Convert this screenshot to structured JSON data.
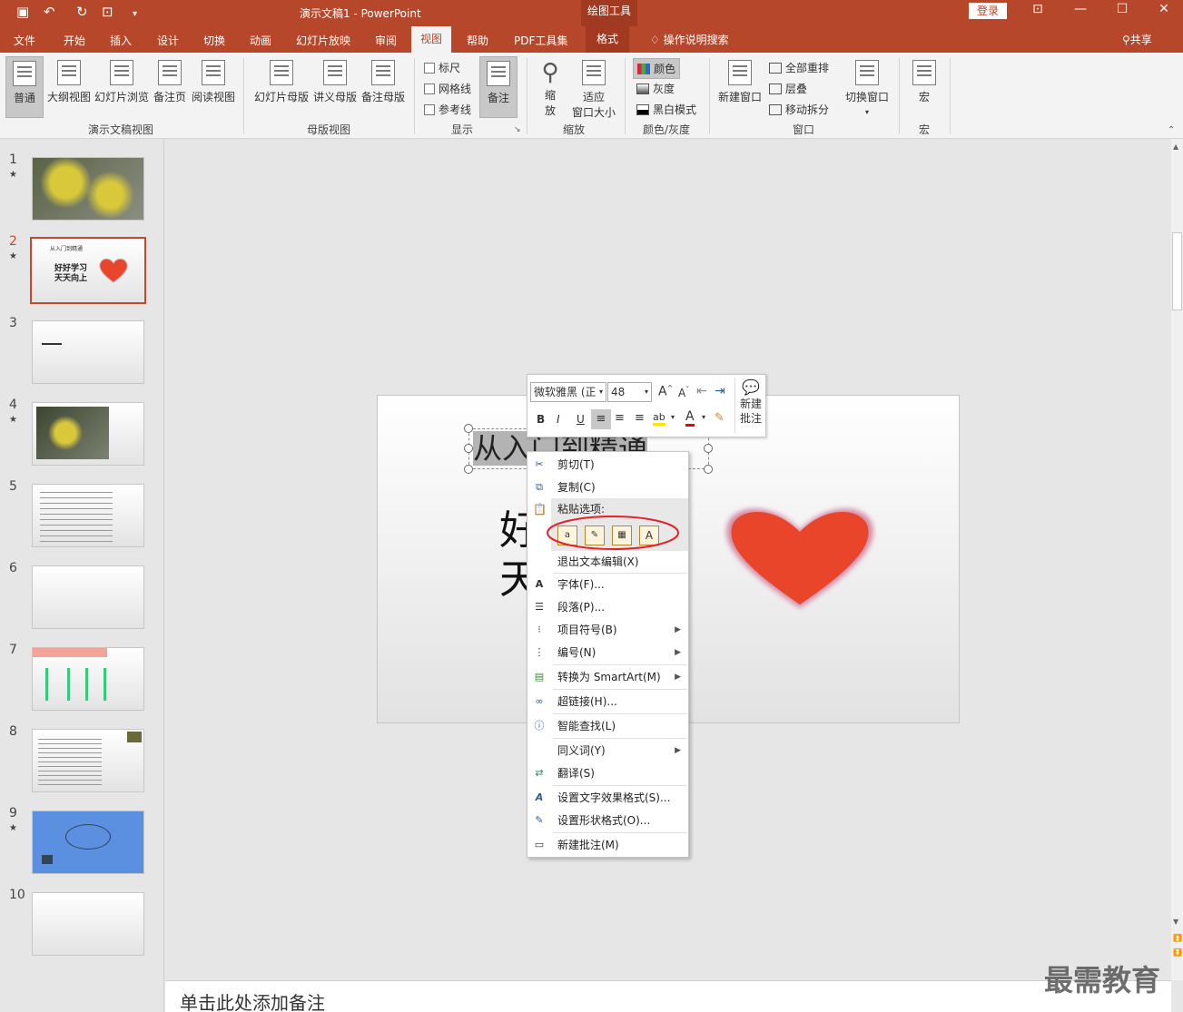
{
  "quick_access": {
    "save_icon": "save-icon",
    "undo_icon": "undo-icon",
    "redo_icon": "redo-icon"
  },
  "title": "演示文稿1  -  PowerPoint",
  "tool_context": "绘图工具",
  "login_label": "登录",
  "window_buttons": [
    "ribbon-display-icon",
    "minimize-icon",
    "maximize-icon",
    "close-icon"
  ],
  "tabs": [
    "文件",
    "开始",
    "插入",
    "设计",
    "切换",
    "动画",
    "幻灯片放映",
    "审阅",
    "视图",
    "帮助",
    "PDF工具集",
    "格式"
  ],
  "active_tab": "视图",
  "search_label": "操作说明搜索",
  "share_label": "共享",
  "ribbon": {
    "presentation_views": {
      "label": "演示文稿视图",
      "buttons": [
        "普通",
        "大纲视图",
        "幻灯片浏览",
        "备注页",
        "阅读视图"
      ]
    },
    "master_views": {
      "label": "母版视图",
      "buttons": [
        "幻灯片母版",
        "讲义母版",
        "备注母版"
      ]
    },
    "show": {
      "label": "显示",
      "checkboxes": [
        "标尺",
        "网格线",
        "参考线"
      ],
      "notes_button": "备注"
    },
    "zoom": {
      "label": "缩放",
      "zoom_top": "缩",
      "zoom_bottom": "放",
      "fit_top": "适应",
      "fit_bottom": "窗口大小"
    },
    "color": {
      "label": "颜色/灰度",
      "options": [
        "颜色",
        "灰度",
        "黑白模式"
      ]
    },
    "window": {
      "label": "窗口",
      "new_window": "新建窗口",
      "options": [
        "全部重排",
        "层叠",
        "移动拆分"
      ],
      "switch": "切换窗口"
    },
    "macro": {
      "label": "宏",
      "button": "宏"
    }
  },
  "slides": [
    {
      "num": "1",
      "star": "★"
    },
    {
      "num": "2",
      "star": "★",
      "title": "从入门到精通",
      "line1": "好好学习",
      "line2": "天天向上"
    },
    {
      "num": "3",
      "star": ""
    },
    {
      "num": "4",
      "star": "★"
    },
    {
      "num": "5",
      "star": ""
    },
    {
      "num": "6",
      "star": ""
    },
    {
      "num": "7",
      "star": ""
    },
    {
      "num": "8",
      "star": ""
    },
    {
      "num": "9",
      "star": "★"
    },
    {
      "num": "10",
      "star": ""
    }
  ],
  "main_slide": {
    "title_text": "从入门到精通",
    "body_char1": "好",
    "body_char2": "天"
  },
  "mini_toolbar": {
    "font_name": "微软雅黑 (正",
    "font_size": "48",
    "new_comment_top": "新建",
    "new_comment_bottom": "批注",
    "bold": "B",
    "italic": "I",
    "underline": "U"
  },
  "context_menu": {
    "items": [
      {
        "label": "剪切(T)",
        "icon": "scissors-icon"
      },
      {
        "label": "复制(C)",
        "icon": "copy-icon"
      },
      {
        "label": "粘贴选项:",
        "icon": "paste-icon"
      },
      {
        "label": "退出文本编辑(X)",
        "icon": ""
      },
      {
        "label": "字体(F)...",
        "icon": "font-icon"
      },
      {
        "label": "段落(P)...",
        "icon": "paragraph-icon"
      },
      {
        "label": "项目符号(B)",
        "icon": "bullets-icon",
        "submenu": true
      },
      {
        "label": "编号(N)",
        "icon": "numbering-icon",
        "submenu": true
      },
      {
        "label": "转换为 SmartArt(M)",
        "icon": "smartart-icon",
        "submenu": true
      },
      {
        "label": "超链接(H)...",
        "icon": "link-icon"
      },
      {
        "label": "智能查找(L)",
        "icon": "smart-lookup-icon"
      },
      {
        "label": "同义词(Y)",
        "icon": "",
        "submenu": true
      },
      {
        "label": "翻译(S)",
        "icon": "translate-icon"
      },
      {
        "label": "设置文字效果格式(S)...",
        "icon": "text-effects-icon"
      },
      {
        "label": "设置形状格式(O)...",
        "icon": "shape-format-icon"
      },
      {
        "label": "新建批注(M)",
        "icon": "comment-icon"
      }
    ]
  },
  "notes_placeholder": "单击此处添加备注",
  "watermark": "最需教育",
  "colors": {
    "accent": "#b7472a",
    "heart": "#e8452a"
  }
}
